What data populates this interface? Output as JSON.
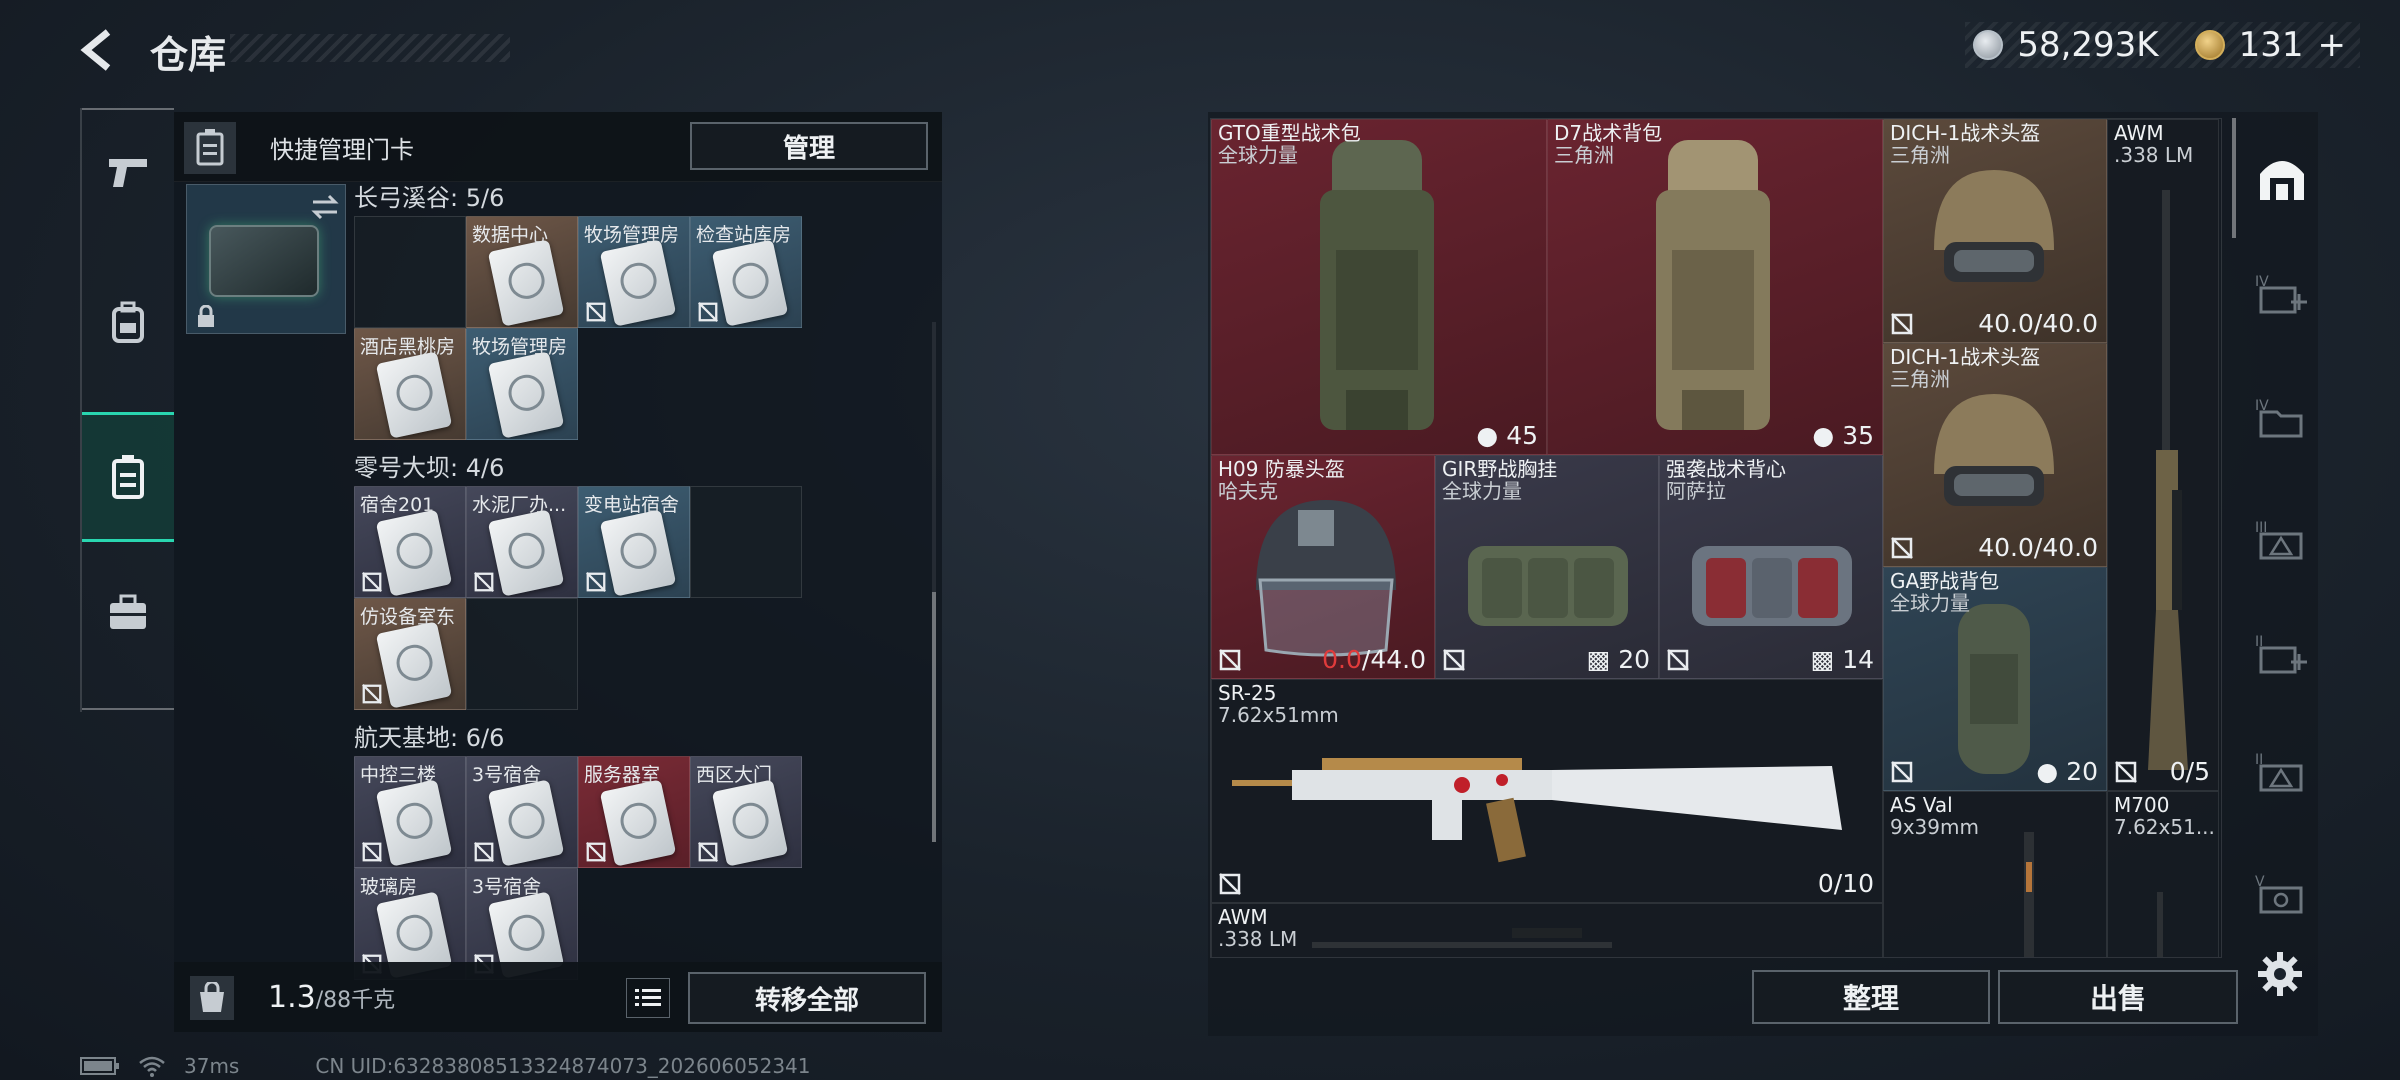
{
  "header": {
    "title": "仓库"
  },
  "currency": {
    "silver": "58,293K",
    "gold": "131",
    "plus": "+"
  },
  "quick_manage": {
    "label": "快捷管理门卡",
    "manage_button": "管理"
  },
  "sections": [
    {
      "title": "长弓溪谷: 5/6",
      "cards": [
        {
          "label": "",
          "color": "empty"
        },
        {
          "label": "数据中心",
          "color": "brown"
        },
        {
          "label": "牧场管理房",
          "color": "blue"
        },
        {
          "label": "检查站库房",
          "color": "blue"
        },
        {
          "label": "酒店黑桃房",
          "color": "brown"
        },
        {
          "label": "牧场管理房",
          "color": "blue"
        }
      ]
    },
    {
      "title": "零号大坝: 4/6",
      "cards": [
        {
          "label": "宿舍201",
          "color": "gray"
        },
        {
          "label": "水泥厂办...",
          "color": "gray"
        },
        {
          "label": "变电站宿舍",
          "color": "blue"
        },
        {
          "label": "",
          "color": "empty"
        },
        {
          "label": "仿设备室东",
          "color": "brown"
        },
        {
          "label": "",
          "color": "empty"
        }
      ]
    },
    {
      "title": "航天基地: 6/6",
      "cards": [
        {
          "label": "中控三楼",
          "color": "gray"
        },
        {
          "label": "3号宿舍",
          "color": "gray"
        },
        {
          "label": "服务器室",
          "color": "red"
        },
        {
          "label": "西区大门",
          "color": "gray"
        },
        {
          "label": "玻璃房",
          "color": "gray"
        },
        {
          "label": "3号宿舍",
          "color": "gray"
        }
      ]
    }
  ],
  "bottom_left": {
    "weight": "1.3",
    "capacity": "/88千克",
    "transfer_button": "转移全部"
  },
  "status_bar": {
    "ping": "37ms",
    "uid": "CN UID:63283808513324874073_202606052341"
  },
  "items": {
    "gto": {
      "name": "GTO重型战术包",
      "sub": "全球力量",
      "value": "45"
    },
    "d7": {
      "name": "D7战术背包",
      "sub": "三角洲",
      "value": "35"
    },
    "dich1": {
      "name": "DICH-1战术头盔",
      "sub": "三角洲",
      "value": "40.0/40.0"
    },
    "dich2": {
      "name": "DICH-1战术头盔",
      "sub": "三角洲",
      "value": "40.0/40.0"
    },
    "awm1": {
      "name": "AWM",
      "sub": ".338 LM",
      "value": "0/5"
    },
    "h09": {
      "name": "H09 防暴头盔",
      "sub": "哈夫克",
      "value_red": "0.0",
      "value_rest": "/44.0"
    },
    "gir": {
      "name": "GIR野战胸挂",
      "sub": "全球力量",
      "value": "20"
    },
    "qx": {
      "name": "强袭战术背心",
      "sub": "阿萨拉",
      "value": "14"
    },
    "ga": {
      "name": "GA野战背包",
      "sub": "全球力量",
      "value": "20"
    },
    "sr25": {
      "name": "SR-25",
      "sub": "7.62x51mm",
      "value": "0/10"
    },
    "asval": {
      "name": "AS Val",
      "sub": "9x39mm"
    },
    "m700": {
      "name": "M700",
      "sub": "7.62x51..."
    },
    "awm2": {
      "name": "AWM",
      "sub": ".338 LM"
    }
  },
  "actions": {
    "sort": "整理",
    "sell": "出售"
  }
}
